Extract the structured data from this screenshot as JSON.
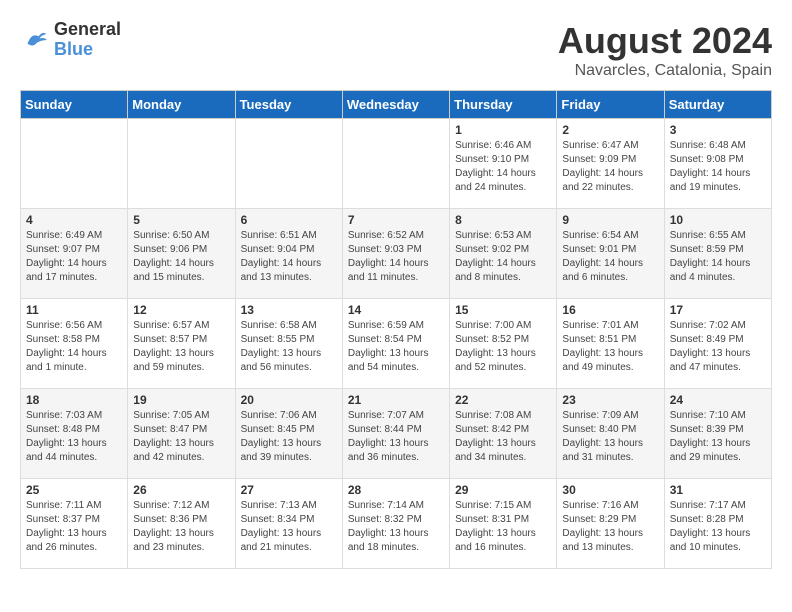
{
  "logo": {
    "line1": "General",
    "line2": "Blue"
  },
  "title": "August 2024",
  "subtitle": "Navarcles, Catalonia, Spain",
  "headers": [
    "Sunday",
    "Monday",
    "Tuesday",
    "Wednesday",
    "Thursday",
    "Friday",
    "Saturday"
  ],
  "weeks": [
    [
      {
        "day": "",
        "detail": ""
      },
      {
        "day": "",
        "detail": ""
      },
      {
        "day": "",
        "detail": ""
      },
      {
        "day": "",
        "detail": ""
      },
      {
        "day": "1",
        "detail": "Sunrise: 6:46 AM\nSunset: 9:10 PM\nDaylight: 14 hours\nand 24 minutes."
      },
      {
        "day": "2",
        "detail": "Sunrise: 6:47 AM\nSunset: 9:09 PM\nDaylight: 14 hours\nand 22 minutes."
      },
      {
        "day": "3",
        "detail": "Sunrise: 6:48 AM\nSunset: 9:08 PM\nDaylight: 14 hours\nand 19 minutes."
      }
    ],
    [
      {
        "day": "4",
        "detail": "Sunrise: 6:49 AM\nSunset: 9:07 PM\nDaylight: 14 hours\nand 17 minutes."
      },
      {
        "day": "5",
        "detail": "Sunrise: 6:50 AM\nSunset: 9:06 PM\nDaylight: 14 hours\nand 15 minutes."
      },
      {
        "day": "6",
        "detail": "Sunrise: 6:51 AM\nSunset: 9:04 PM\nDaylight: 14 hours\nand 13 minutes."
      },
      {
        "day": "7",
        "detail": "Sunrise: 6:52 AM\nSunset: 9:03 PM\nDaylight: 14 hours\nand 11 minutes."
      },
      {
        "day": "8",
        "detail": "Sunrise: 6:53 AM\nSunset: 9:02 PM\nDaylight: 14 hours\nand 8 minutes."
      },
      {
        "day": "9",
        "detail": "Sunrise: 6:54 AM\nSunset: 9:01 PM\nDaylight: 14 hours\nand 6 minutes."
      },
      {
        "day": "10",
        "detail": "Sunrise: 6:55 AM\nSunset: 8:59 PM\nDaylight: 14 hours\nand 4 minutes."
      }
    ],
    [
      {
        "day": "11",
        "detail": "Sunrise: 6:56 AM\nSunset: 8:58 PM\nDaylight: 14 hours\nand 1 minute."
      },
      {
        "day": "12",
        "detail": "Sunrise: 6:57 AM\nSunset: 8:57 PM\nDaylight: 13 hours\nand 59 minutes."
      },
      {
        "day": "13",
        "detail": "Sunrise: 6:58 AM\nSunset: 8:55 PM\nDaylight: 13 hours\nand 56 minutes."
      },
      {
        "day": "14",
        "detail": "Sunrise: 6:59 AM\nSunset: 8:54 PM\nDaylight: 13 hours\nand 54 minutes."
      },
      {
        "day": "15",
        "detail": "Sunrise: 7:00 AM\nSunset: 8:52 PM\nDaylight: 13 hours\nand 52 minutes."
      },
      {
        "day": "16",
        "detail": "Sunrise: 7:01 AM\nSunset: 8:51 PM\nDaylight: 13 hours\nand 49 minutes."
      },
      {
        "day": "17",
        "detail": "Sunrise: 7:02 AM\nSunset: 8:49 PM\nDaylight: 13 hours\nand 47 minutes."
      }
    ],
    [
      {
        "day": "18",
        "detail": "Sunrise: 7:03 AM\nSunset: 8:48 PM\nDaylight: 13 hours\nand 44 minutes."
      },
      {
        "day": "19",
        "detail": "Sunrise: 7:05 AM\nSunset: 8:47 PM\nDaylight: 13 hours\nand 42 minutes."
      },
      {
        "day": "20",
        "detail": "Sunrise: 7:06 AM\nSunset: 8:45 PM\nDaylight: 13 hours\nand 39 minutes."
      },
      {
        "day": "21",
        "detail": "Sunrise: 7:07 AM\nSunset: 8:44 PM\nDaylight: 13 hours\nand 36 minutes."
      },
      {
        "day": "22",
        "detail": "Sunrise: 7:08 AM\nSunset: 8:42 PM\nDaylight: 13 hours\nand 34 minutes."
      },
      {
        "day": "23",
        "detail": "Sunrise: 7:09 AM\nSunset: 8:40 PM\nDaylight: 13 hours\nand 31 minutes."
      },
      {
        "day": "24",
        "detail": "Sunrise: 7:10 AM\nSunset: 8:39 PM\nDaylight: 13 hours\nand 29 minutes."
      }
    ],
    [
      {
        "day": "25",
        "detail": "Sunrise: 7:11 AM\nSunset: 8:37 PM\nDaylight: 13 hours\nand 26 minutes."
      },
      {
        "day": "26",
        "detail": "Sunrise: 7:12 AM\nSunset: 8:36 PM\nDaylight: 13 hours\nand 23 minutes."
      },
      {
        "day": "27",
        "detail": "Sunrise: 7:13 AM\nSunset: 8:34 PM\nDaylight: 13 hours\nand 21 minutes."
      },
      {
        "day": "28",
        "detail": "Sunrise: 7:14 AM\nSunset: 8:32 PM\nDaylight: 13 hours\nand 18 minutes."
      },
      {
        "day": "29",
        "detail": "Sunrise: 7:15 AM\nSunset: 8:31 PM\nDaylight: 13 hours\nand 16 minutes."
      },
      {
        "day": "30",
        "detail": "Sunrise: 7:16 AM\nSunset: 8:29 PM\nDaylight: 13 hours\nand 13 minutes."
      },
      {
        "day": "31",
        "detail": "Sunrise: 7:17 AM\nSunset: 8:28 PM\nDaylight: 13 hours\nand 10 minutes."
      }
    ]
  ]
}
